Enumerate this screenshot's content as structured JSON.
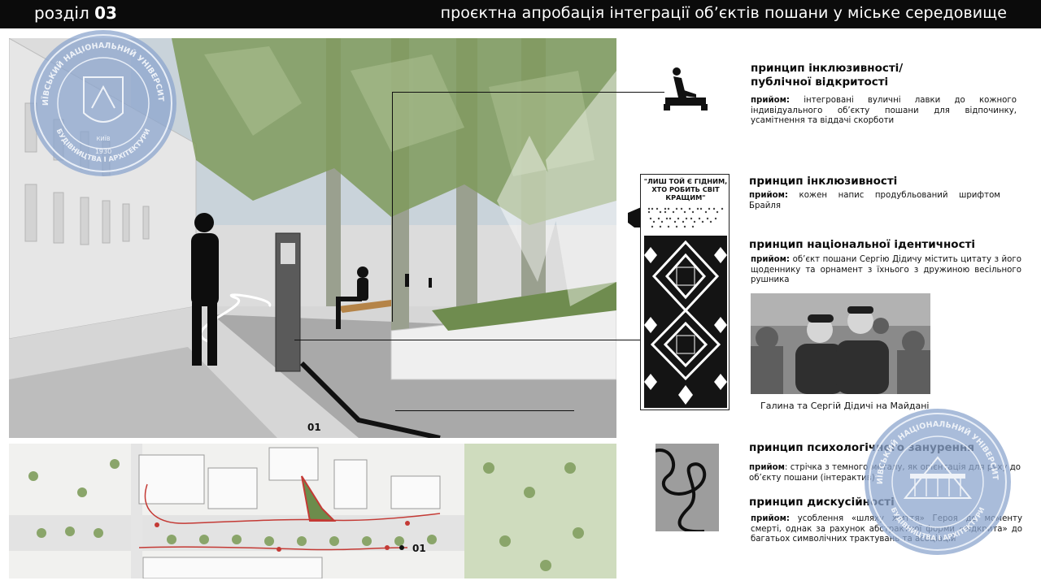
{
  "header": {
    "section_word": "розділ",
    "section_number": "03",
    "title": "проєктна апробація інтеграції об’єктів пошани у міське середовище"
  },
  "render": {
    "label": "01"
  },
  "plan": {
    "label": "01"
  },
  "plaque": {
    "quote": "\"ЛИШ ТОЙ Є ГІДНИМ, ХТО РОБИТЬ СВІТ КРАЩИМ\""
  },
  "principles": [
    {
      "title": "принцип інклюзивності/ публічної відкритості",
      "term": "прийом:",
      "text": "інтегровані вуличні лавки до кожного індивідуального об’єкту пошани для відпочинку, усамітнення та віддачі скорботи"
    },
    {
      "title": "принцип інклюзивності",
      "term": "прийом:",
      "text": "кожен напис продубльований шрифтом Брайля"
    },
    {
      "title": "принцип національної ідентичності",
      "term": "прийом:",
      "text": "об’єкт пошани Сергію Дідичу містить цитату з його щоденнику та орнамент з їхнього з дружиною весільного рушника"
    },
    {
      "title": "принцип психологічного занурення",
      "term": "прийом",
      "text": ": стрічка з темного металу, як орієнтація для руху до об’єкту пошани (інтерактив)"
    },
    {
      "title": "принцип дискусійності",
      "term": "прийом:",
      "text": "усоблення «шляху життя» Героя до моменту смерті, однак за рахунок абстрактної форми «відкрита» до багатьох символічних трактувань та асоціацій"
    }
  ],
  "photo": {
    "caption": "Галина та Сергій Дідичі на Майдані"
  },
  "icons": {
    "bench": "bench-person-icon",
    "braille_hand": "hand-touch-icon"
  },
  "seals": {
    "left_text_top": "КИЇВСЬКИЙ НАЦІОНАЛЬНИЙ УНІВЕРСИТЕТ",
    "left_text_bottom": "БУДІВНИЦТВА І АРХІТЕКТУРИ",
    "left_year": "1930",
    "left_city": "КИЇВ",
    "right_text_top": "КИЇВСЬКИЙ НАЦІОНАЛЬНИЙ УНІВЕРСИТЕТ",
    "right_text_bottom": "БУДІВНИЦТВА І АРХІТЕКТУРИ"
  },
  "colors": {
    "header_bg": "#0b0b0b",
    "seal_blue": "#8ca5cd",
    "foliage": "#7f9a5c",
    "route_red": "#c43a35"
  }
}
